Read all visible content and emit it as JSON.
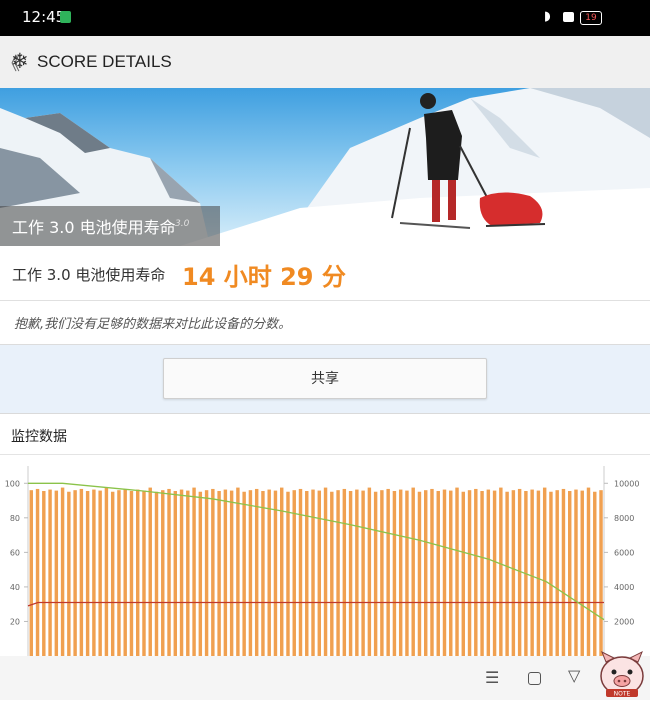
{
  "status_bar": {
    "time": "12:45",
    "battery": "19"
  },
  "top_bar": {
    "back_glyph": "《",
    "logo_glyph": "❄",
    "title": "SCORE DETAILS"
  },
  "hero": {
    "test_name": "工作 3.0 电池使用寿命",
    "version": "3.0"
  },
  "result": {
    "label": "工作 3.0 电池使用寿命",
    "score": "14 小时 29 分"
  },
  "notice": {
    "text": "抱歉,我们没有足够的数据来对比此设备的分数。"
  },
  "share_button": {
    "label": "共享"
  },
  "monitoring": {
    "title": "监控数据"
  },
  "nav_bar": {
    "menu_glyph": "☰",
    "back_glyph": "▽"
  },
  "colors": {
    "accent": "#f08a22",
    "bar": "#f0a050",
    "battery_line": "#8bc34a",
    "temperature_line": "#c0392b"
  },
  "chart_data": {
    "type": "bar",
    "left_axis_ticks": [
      "100",
      "80",
      "60",
      "40",
      "20"
    ],
    "right_axis_ticks": [
      "10000",
      "8000",
      "6000",
      "4000",
      "2000"
    ],
    "left_ylim": [
      0,
      110
    ],
    "right_ylim": [
      0,
      11000
    ],
    "bar_count": 92,
    "bar_level": 96,
    "battery_line": [
      [
        0,
        100
      ],
      [
        0.06,
        100
      ],
      [
        0.2,
        95.5
      ],
      [
        0.32,
        91
      ],
      [
        0.44,
        84
      ],
      [
        0.56,
        76
      ],
      [
        0.68,
        67
      ],
      [
        0.8,
        56
      ],
      [
        0.9,
        43
      ],
      [
        1.0,
        21
      ]
    ],
    "temperature_level": 31
  },
  "mascot_text": "NOTE"
}
